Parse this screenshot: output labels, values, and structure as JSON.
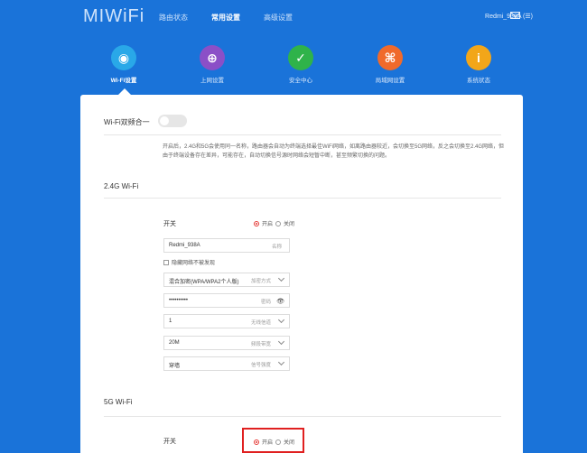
{
  "header": {
    "logo": "MIWiFi",
    "nav": [
      "路由状态",
      "常用设置",
      "高级设置"
    ],
    "nav_active": 1,
    "user": "Redmi_938A (☰)",
    "mail_icon": "mail-icon"
  },
  "icons": [
    {
      "label": "Wi-Fi设置",
      "color": "#29a8e8",
      "icon": "wifi-icon",
      "glyph": "◉",
      "active": true
    },
    {
      "label": "上网设置",
      "color": "#8b4fc7",
      "icon": "globe-icon",
      "glyph": "⊕",
      "active": false
    },
    {
      "label": "安全中心",
      "color": "#2fb34a",
      "icon": "shield-icon",
      "glyph": "✓",
      "active": false
    },
    {
      "label": "局域网设置",
      "color": "#f06a2b",
      "icon": "network-icon",
      "glyph": "⌘",
      "active": false
    },
    {
      "label": "系统状态",
      "color": "#f2a619",
      "icon": "info-icon",
      "glyph": "i",
      "active": false
    }
  ],
  "wifi_dual": {
    "title": "Wi-Fi双频合一",
    "description": "开启后，2.4G和5G会使用同一名称，路由器会自动为终端选择最佳WiFi网络，如离路由器较近，会切换至5G网络，反之会切换至2.4G网络，但由于终端设备存在差异，可能存在，自动切换信号源时网络会短暂中断，甚至频繁切换的问题。"
  },
  "wifi24": {
    "section_title": "2.4G Wi-Fi",
    "switch_label": "开关",
    "on_label": "开启",
    "off_label": "关闭",
    "name_value": "Redmi_938A",
    "name_hint": "名称",
    "hide_network_label": "隐藏网络不被发现",
    "encryption_value": "混合加密(WPA/WPA2个人版)",
    "encryption_hint": "加密方式",
    "password_value": "••••••••••",
    "password_hint": "密码",
    "channel_value": "1",
    "channel_hint": "无线信道",
    "bandwidth_value": "20M",
    "bandwidth_hint": "频段带宽",
    "signal_value": "穿墙",
    "signal_hint": "信号强度"
  },
  "wifi5": {
    "section_title": "5G Wi-Fi",
    "switch_label": "开关",
    "on_label": "开启",
    "off_label": "关闭"
  }
}
